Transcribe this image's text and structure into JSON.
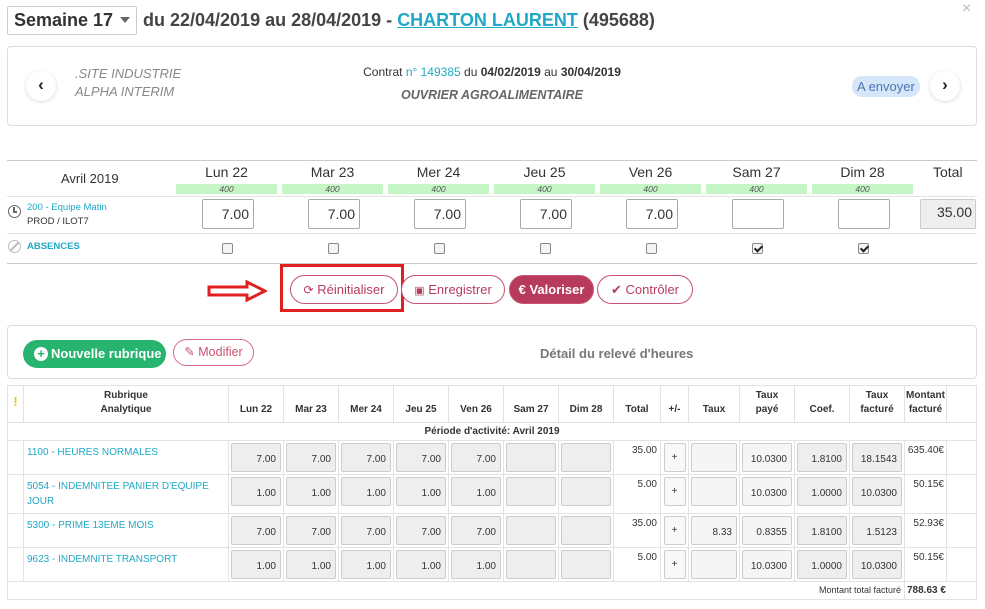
{
  "header": {
    "week_select": "Semaine 17",
    "range": "du 22/04/2019 au 28/04/2019 -",
    "person": "CHARTON LAURENT",
    "person_id": "(495688)",
    "close": "×"
  },
  "contract": {
    "site_line1": ".SITE INDUSTRIE",
    "site_line2": "ALPHA INTERIM",
    "contrat_label": "Contrat",
    "contrat_num": "n° 149385",
    "du": "du",
    "start": "04/02/2019",
    "au": "au",
    "end": "30/04/2019",
    "job": "OUVRIER AGROALIMENTAIRE",
    "status": "A envoyer",
    "prev": "‹",
    "next": "›"
  },
  "planning": {
    "month": "Avril 2019",
    "total_label": "Total",
    "days": [
      {
        "label": "Lun 22",
        "code": "400",
        "hours": "7.00",
        "absence": false
      },
      {
        "label": "Mar 23",
        "code": "400",
        "hours": "7.00",
        "absence": false
      },
      {
        "label": "Mer 24",
        "code": "400",
        "hours": "7.00",
        "absence": false
      },
      {
        "label": "Jeu 25",
        "code": "400",
        "hours": "7.00",
        "absence": false
      },
      {
        "label": "Ven 26",
        "code": "400",
        "hours": "7.00",
        "absence": false
      },
      {
        "label": "Sam 27",
        "code": "400",
        "hours": "",
        "absence": true
      },
      {
        "label": "Dim 28",
        "code": "400",
        "hours": "",
        "absence": true
      }
    ],
    "team": "200 - Equipe Matin",
    "prod": "PROD / ILOT7",
    "total": "35.00",
    "absences_label": "ABSENCES"
  },
  "actions": {
    "reset": "Réinitialiser",
    "save": "Enregistrer",
    "value": "€ Valoriser",
    "check": "Contrôler"
  },
  "detail_panel": {
    "new_rubric": "Nouvelle rubrique",
    "modify": "Modifier",
    "title": "Détail du relevé d'heures"
  },
  "detail_table": {
    "headers": {
      "rubrique": "Rubrique",
      "analytique": "Analytique",
      "days": [
        "Lun 22",
        "Mar 23",
        "Mer 24",
        "Jeu 25",
        "Ven 26",
        "Sam 27",
        "Dim 28"
      ],
      "total": "Total",
      "pm": "+/-",
      "taux": "Taux",
      "taux_paye_1": "Taux",
      "taux_paye_2": "payé",
      "coef": "Coef.",
      "taux_fact_1": "Taux",
      "taux_fact_2": "facturé",
      "montant_1": "Montant",
      "montant_2": "facturé"
    },
    "period": "Période d'activité: Avril 2019",
    "rows": [
      {
        "label": "1100 - HEURES NORMALES",
        "days": [
          "7.00",
          "7.00",
          "7.00",
          "7.00",
          "7.00",
          "",
          ""
        ],
        "total": "35.00",
        "pm": "+",
        "taux": "",
        "taux_paye": "10.0300",
        "coef": "1.8100",
        "taux_facture": "18.1543",
        "montant": "635.40€"
      },
      {
        "label": "5054 - INDEMNITEE PANIER D'EQUIPE JOUR",
        "days": [
          "1.00",
          "1.00",
          "1.00",
          "1.00",
          "1.00",
          "",
          ""
        ],
        "total": "5.00",
        "pm": "+",
        "taux": "",
        "taux_paye": "10.0300",
        "coef": "1.0000",
        "taux_facture": "10.0300",
        "montant": "50.15€"
      },
      {
        "label": "5300 - PRIME 13EME MOIS",
        "days": [
          "7.00",
          "7.00",
          "7.00",
          "7.00",
          "7.00",
          "",
          ""
        ],
        "total": "35.00",
        "pm": "+",
        "taux": "8.33",
        "taux_paye": "0.8355",
        "coef": "1.8100",
        "taux_facture": "1.5123",
        "montant": "52.93€"
      },
      {
        "label": "9623 - INDEMNITE TRANSPORT",
        "days": [
          "1.00",
          "1.00",
          "1.00",
          "1.00",
          "1.00",
          "",
          ""
        ],
        "total": "5.00",
        "pm": "+",
        "taux": "",
        "taux_paye": "10.0300",
        "coef": "1.0000",
        "taux_facture": "10.0300",
        "montant": "50.15€"
      }
    ],
    "footer_label": "Montant total facturé",
    "footer_value": "788.63 €"
  },
  "colors": {
    "accent": "#1fa9c5",
    "primary": "#b83b5e",
    "success": "#27b46e",
    "highlight": "#e02020"
  }
}
